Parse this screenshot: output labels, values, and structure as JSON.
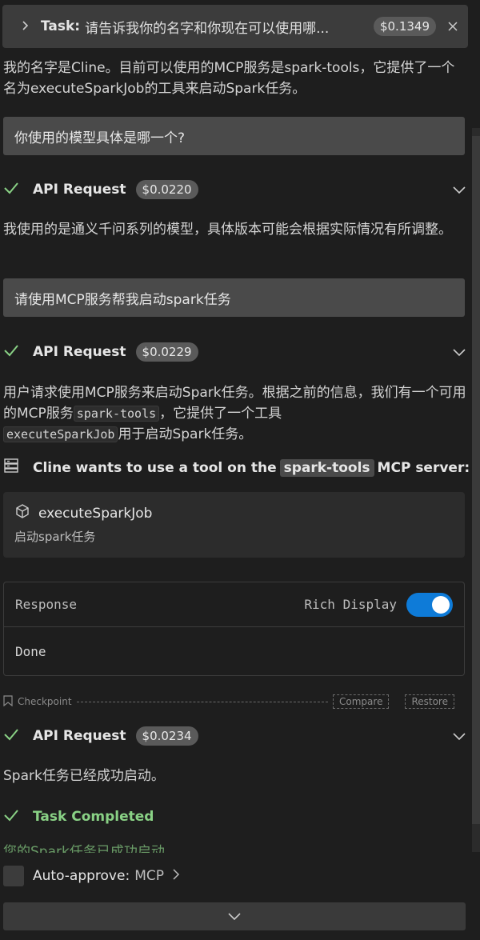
{
  "header": {
    "task_label": "Task:",
    "task_text": "请告诉我你的名字和你现在可以使用哪...",
    "cost": "$0.1349"
  },
  "messages": {
    "intro": "我的名字是Cline。目前可以使用的MCP服务是spark-tools，它提供了一个名为executeSparkJob的工具来启动Spark任务。",
    "user_q1": "你使用的模型具体是哪一个?",
    "api1": {
      "label": "API Request",
      "cost": "$0.0220"
    },
    "answer1": "我使用的是通义千问系列的模型，具体版本可能会根据实际情况有所调整。",
    "user_q2": "请使用MCP服务帮我启动spark任务",
    "api2": {
      "label": "API Request",
      "cost": "$0.0229"
    },
    "answer2_part1": "用户请求使用MCP服务来启动Spark任务。根据之前的信息，我们有一个可用的MCP服务",
    "answer2_code1": "spark-tools",
    "answer2_part2": "，它提供了一个工具",
    "answer2_code2": "executeSparkJob",
    "answer2_part3": "用于启动Spark任务。",
    "api3": {
      "label": "API Request",
      "cost": "$0.0234"
    },
    "answer3": "Spark任务已经成功启动。",
    "task_completed": "Task Completed",
    "faded": "您的Spark任务已成功启动。"
  },
  "tool": {
    "prefix": "Cline wants to use a tool on the",
    "server": "spark-tools",
    "suffix": "MCP server:",
    "name": "executeSparkJob",
    "description": "启动spark任务"
  },
  "response": {
    "label": "Response",
    "rich_display": "Rich Display",
    "rich_display_on": true,
    "body": "Done"
  },
  "checkpoint": {
    "label": "Checkpoint",
    "compare": "Compare",
    "restore": "Restore"
  },
  "footer": {
    "auto_approve_label": "Auto-approve:",
    "auto_approve_value": "MCP"
  },
  "colors": {
    "background": "#1e1e1e",
    "success": "#89d185",
    "toggle": "#0e7bd8"
  }
}
